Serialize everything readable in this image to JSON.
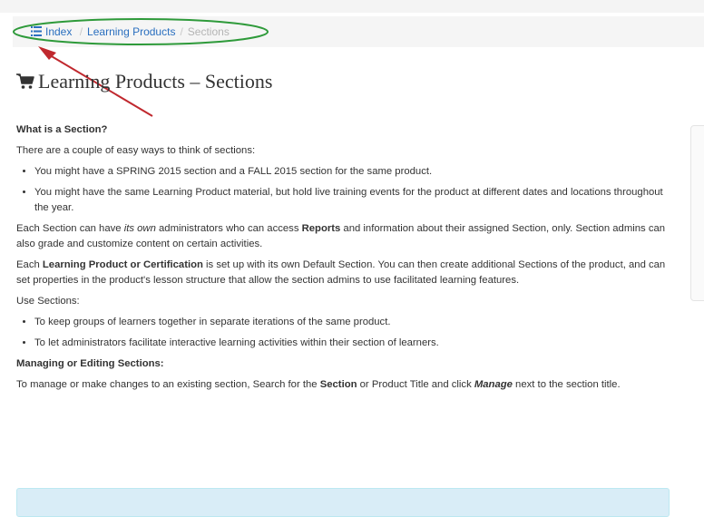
{
  "breadcrumb": {
    "items": [
      "Index",
      "Learning Products",
      "Sections"
    ],
    "separator": "/"
  },
  "page": {
    "title": "Learning Products – Sections",
    "title_icon": "shopping-cart-icon"
  },
  "content": {
    "what_heading": "What is a Section?",
    "intro": "There are a couple of easy ways to think of sections:",
    "ways": [
      "You might have a SPRING 2015 section and a FALL 2015 section for the same product.",
      "You might have the same Learning Product material, but hold live training events for the product at different dates and locations throughout the year."
    ],
    "admins": {
      "a": "Each Section can have ",
      "b": "its own",
      "c": " administrators who can access ",
      "d": "Reports",
      "e": " and information about their assigned Section, only. Section admins can also grade and customize content on certain activities."
    },
    "default_section": {
      "a": "Each ",
      "b": "Learning Product or Certification",
      "c": " is set up with its own Default Section. You can then create additional Sections of the product, and can set properties in the product's lesson structure that allow the section admins to use facilitated learning features."
    },
    "use_intro": "Use Sections:",
    "uses": [
      "To keep groups of learners together in separate iterations of the same product.",
      "To let administrators facilitate interactive learning activities within their section of learners."
    ],
    "managing_heading": "Managing or Editing Sections:",
    "managing": {
      "a": "To manage or make changes to an existing section, Search for the ",
      "b": "Section",
      "c": " or Product Title and click ",
      "d": "Manage",
      "e": " next to the section title."
    }
  },
  "colors": {
    "link": "#2a6fbf",
    "annotation_ellipse": "#2e9a3a",
    "annotation_arrow": "#c0282e",
    "info_box": "#d9edf7"
  }
}
